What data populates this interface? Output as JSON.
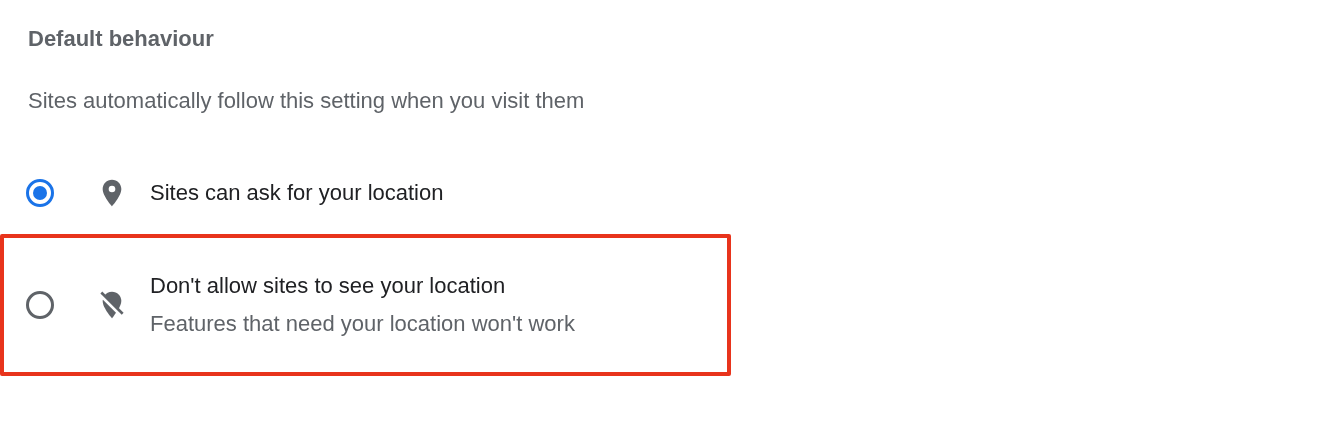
{
  "section": {
    "title": "Default behaviour",
    "description": "Sites automatically follow this setting when you visit them"
  },
  "options": [
    {
      "kind": "location",
      "label": "Sites can ask for your location",
      "selected": true,
      "highlighted": false
    },
    {
      "kind": "location-off",
      "label": "Don't allow sites to see your location",
      "sublabel": "Features that need your location won't work",
      "selected": false,
      "highlighted": true
    }
  ]
}
